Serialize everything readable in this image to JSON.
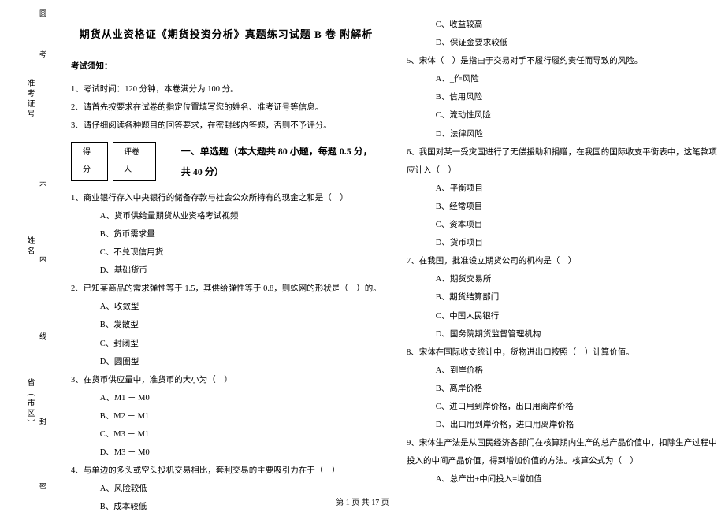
{
  "margin": {
    "round": "圆",
    "exam_no_label": "准考证号",
    "name_label": "姓名",
    "province_label": "省（市区）",
    "seal_labels": [
      "考",
      "不",
      "内",
      "线",
      "封",
      "密"
    ]
  },
  "title": "期货从业资格证《期货投资分析》真题练习试题 B 卷 附解析",
  "notice_header": "考试须知：",
  "notices": [
    "1、考试时间：120 分钟，本卷满分为 100 分。",
    "2、请首先按要求在试卷的指定位置填写您的姓名、准考证号等信息。",
    "3、请仔细阅读各种题目的回答要求，在密封线内答题，否则不予评分。"
  ],
  "score": {
    "label1": "得分",
    "label2": "评卷人"
  },
  "section1": "一、单选题（本大题共 80 小题，每题 0.5 分，共 40 分）",
  "questions_left": [
    {
      "stem": "1、商业银行存入中央银行的储备存款与社会公众所持有的现金之和是（　）",
      "opts": [
        "A、货币供给量期货从业资格考试视频",
        "B、货币需求量",
        "C、不兑现信用货",
        "D、基础货币"
      ]
    },
    {
      "stem": "2、已知某商品的需求弹性等于 1.5，其供给弹性等于 0.8，则蛛网的形状是（　）的。",
      "opts": [
        "A、收敛型",
        "B、发散型",
        "C、封闭型",
        "D、圆圈型"
      ]
    },
    {
      "stem": "3、在货币供应量中，准货币的大小为（　）",
      "opts": [
        "A、M1 － M0",
        "B、M2 － M1",
        "C、M3 － M1",
        "D、M3 － M0"
      ]
    },
    {
      "stem": "4、与单边的多头或空头投机交易相比，套利交易的主要吸引力在于（　）",
      "opts": [
        "A、风险较低",
        "B、成本较低"
      ]
    }
  ],
  "questions_right_pre": [
    "C、收益较高",
    "D、保证金要求较低"
  ],
  "questions_right": [
    {
      "stem": "5、宋体（　）是指由于交易对手不履行履约责任而导致的风险。",
      "opts": [
        "A、_作风险",
        "B、信用风险",
        "C、流动性风险",
        "D、法律风险"
      ]
    },
    {
      "stem": "6、我国对某一受灾国进行了无偿援助和捐赠，在我国的国际收支平衡表中，这笔款项应计入（　）",
      "opts": [
        "A、平衡项目",
        "B、经常项目",
        "C、资本项目",
        "D、货币项目"
      ]
    },
    {
      "stem": "7、在我国，批准设立期货公司的机构是（　）",
      "opts": [
        "A、期货交易所",
        "B、期货结算部门",
        "C、中国人民银行",
        "D、国务院期货监督管理机构"
      ]
    },
    {
      "stem": "8、宋体在国际收支统计中，货物进出口按照（　）计算价值。",
      "opts": [
        "A、到岸价格",
        "B、离岸价格",
        "C、进口用到岸价格，出口用离岸价格",
        "D、出口用到岸价格，进口用离岸价格"
      ]
    },
    {
      "stem": "9、宋体生产法是从国民经济各部门在核算期内生产的总产品价值中，扣除生产过程中投入的中间产品价值，得到增加价值的方法。核算公式为（　）",
      "opts": [
        "A、总产出+中间投入=增加值"
      ]
    }
  ],
  "footer": "第 1 页 共 17 页"
}
